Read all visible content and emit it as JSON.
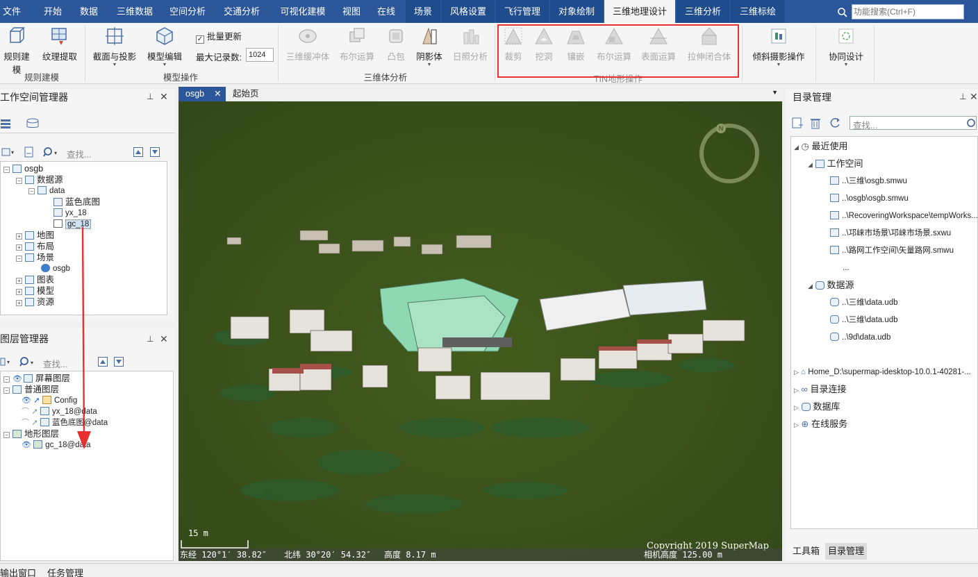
{
  "menu": {
    "tabs": [
      "文件",
      "开始",
      "数据",
      "三维数据",
      "空间分析",
      "交通分析",
      "可视化建模",
      "视图",
      "在线",
      "场景",
      "风格设置",
      "飞行管理",
      "对象绘制",
      "三维地理设计",
      "三维分析",
      "三维标绘"
    ],
    "active_tab": "三维地理设计",
    "search_placeholder": "功能搜索(Ctrl+F)"
  },
  "ribbon": {
    "groups": {
      "rules_model": "规则建模",
      "model_ops": "模型操作",
      "solid_analysis": "三维体分析",
      "tin_ops": "TIN地形操作"
    },
    "buttons": {
      "rule_model": "规则建模",
      "texture_extract": "纹理提取",
      "section_projection": "截面与投影",
      "model_edit": "模型编辑",
      "batch_update": "批量更新",
      "max_records_label": "最大记录数:",
      "max_records_value": "1024",
      "buffer_3d": "三维缓冲体",
      "boolean_op": "布尔运算",
      "convex_hull": "凸包",
      "shadow_body": "阴影体",
      "sunlight_analysis": "日照分析",
      "clip": "裁剪",
      "dig_hole": "挖洞",
      "inlay": "镶嵌",
      "tin_boolean": "布尔运算",
      "surface_op": "表面运算",
      "extrude_close": "拉伸闭合体",
      "oblique_photo": "倾斜摄影操作",
      "collab_design": "协同设计"
    }
  },
  "workspace_panel": {
    "title": "工作空间管理器",
    "search_placeholder": "查找...",
    "tree": {
      "root": "osgb",
      "datasources": "数据源",
      "data": "data",
      "blue_base": "蓝色底图",
      "yx": "yx_18",
      "gc": "gc_18",
      "maps": "地图",
      "layouts": "布局",
      "scenes": "场景",
      "scene_osgb": "osgb",
      "charts": "图表",
      "models": "模型",
      "resources": "资源"
    }
  },
  "layer_panel": {
    "title": "图层管理器",
    "search_placeholder": "查找...",
    "tree": {
      "screen_layers": "屏幕图层",
      "normal_layers": "普通图层",
      "config": "Config",
      "yx_layer": "yx_18@data",
      "blue_layer": "蓝色底图@data",
      "terrain_layers": "地形图层",
      "gc_layer": "gc_18@data"
    }
  },
  "doc_tabs": [
    "osgb",
    "起始页"
  ],
  "viewport": {
    "scale_label": "15 m",
    "copyright": "Copyright 2019 SuperMap",
    "longitude": "东经 120°1′ 38.82″",
    "latitude": "北纬 30°20′ 54.32″",
    "height": "高度 8.17 m",
    "camera_height": "相机高度 125.00 m",
    "compass_label": "N"
  },
  "catalog_panel": {
    "title": "目录管理",
    "search_placeholder": "查找...",
    "recent": "最近使用",
    "workspace": "工作空间",
    "workspace_files": [
      "..\\三维\\osgb.smwu",
      "..\\osgb\\osgb.smwu",
      "..\\RecoveringWorkspace\\tempWorks...",
      "..\\邛崃市场景\\邛崃市场景.sxwu",
      "..\\路网工作空间\\矢量路网.smwu",
      "..."
    ],
    "datasource": "数据源",
    "datasource_files": [
      "..\\三维\\data.udb",
      "..\\三维\\data.udb",
      "..\\9d\\data.udb"
    ],
    "home": "Home_D:\\supermap-idesktop-10.0.1-40281-...",
    "catalog_conn": "目录连接",
    "database": "数据库",
    "online_service": "在线服务",
    "bottom_tabs": [
      "工具箱",
      "目录管理"
    ]
  },
  "bottom_tabs": [
    "输出窗口",
    "任务管理"
  ],
  "colors": {
    "menu_bg": "#2b579a",
    "viewport_bg": "#3b5217",
    "highlight_border": "#e83030"
  }
}
